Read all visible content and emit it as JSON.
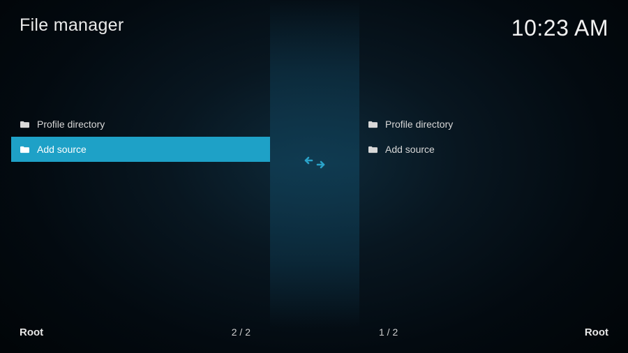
{
  "header": {
    "title": "File manager",
    "clock": "10:23 AM"
  },
  "left_panel": {
    "items": [
      {
        "label": "Profile directory",
        "icon": "folder",
        "selected": false
      },
      {
        "label": "Add source",
        "icon": "folder-plus",
        "selected": true
      }
    ],
    "footer": {
      "path": "Root",
      "count": "2 / 2"
    }
  },
  "right_panel": {
    "items": [
      {
        "label": "Profile directory",
        "icon": "folder",
        "selected": false
      },
      {
        "label": "Add source",
        "icon": "folder-plus",
        "selected": false
      }
    ],
    "footer": {
      "path": "Root",
      "count": "1 / 2"
    }
  },
  "colors": {
    "accent": "#1ea1c7",
    "swap_icon": "#2aa3c9"
  }
}
